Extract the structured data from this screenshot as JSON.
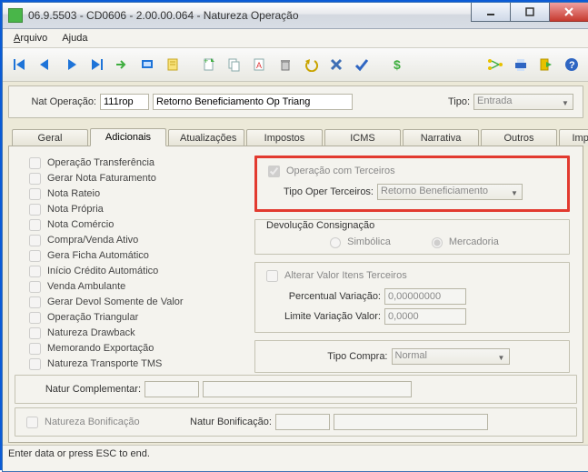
{
  "window": {
    "title": "06.9.5503 - CD0606 - 2.00.00.064 - Natureza Operação"
  },
  "menu": {
    "file": "Arquivo",
    "help": "Ajuda"
  },
  "header": {
    "nat_operacao_label": "Nat Operação:",
    "nat_operacao_code": "111rop",
    "nat_operacao_desc": "Retorno Beneficiamento Op Triang",
    "tipo_label": "Tipo:",
    "tipo_value": "Entrada"
  },
  "tabs": {
    "geral": "Geral",
    "adicionais": "Adicionais",
    "atualizacoes": "Atualizações",
    "impostos": "Impostos",
    "icms": "ICMS",
    "narrativa": "Narrativa",
    "outros": "Outros",
    "importacao": "Importação"
  },
  "checks": [
    "Operação Transferência",
    "Gerar Nota Faturamento",
    "Nota Rateio",
    "Nota Própria",
    "Nota Comércio",
    "Compra/Venda Ativo",
    "Gera Ficha Automático",
    "Início Crédito Automático",
    "Venda Ambulante",
    "Gerar Devol Somente de Valor",
    "Operação Triangular",
    "Natureza Drawback",
    "Memorando Exportação",
    "Natureza Transporte TMS"
  ],
  "terceiros": {
    "oper_terceiros_label": "Operação com Terceiros",
    "tipo_label": "Tipo Oper Terceiros:",
    "tipo_value": "Retorno Beneficiamento"
  },
  "devolucao": {
    "title": "Devolução Consignação",
    "simbolica": "Simbólica",
    "mercadoria": "Mercadoria"
  },
  "alterar": {
    "chk": "Alterar Valor Itens Terceiros",
    "perc_label": "Percentual Variação:",
    "perc_value": "0,00000000",
    "limite_label": "Limite Variação Valor:",
    "limite_value": "0,0000"
  },
  "tipo_compra": {
    "label": "Tipo Compra:",
    "value": "Normal"
  },
  "complementar": {
    "label": "Natur Complementar:"
  },
  "bonificacao": {
    "chk": "Natureza Bonificação",
    "label": "Natur Bonificação:"
  },
  "status": {
    "text": "Enter data or press ESC to end."
  }
}
